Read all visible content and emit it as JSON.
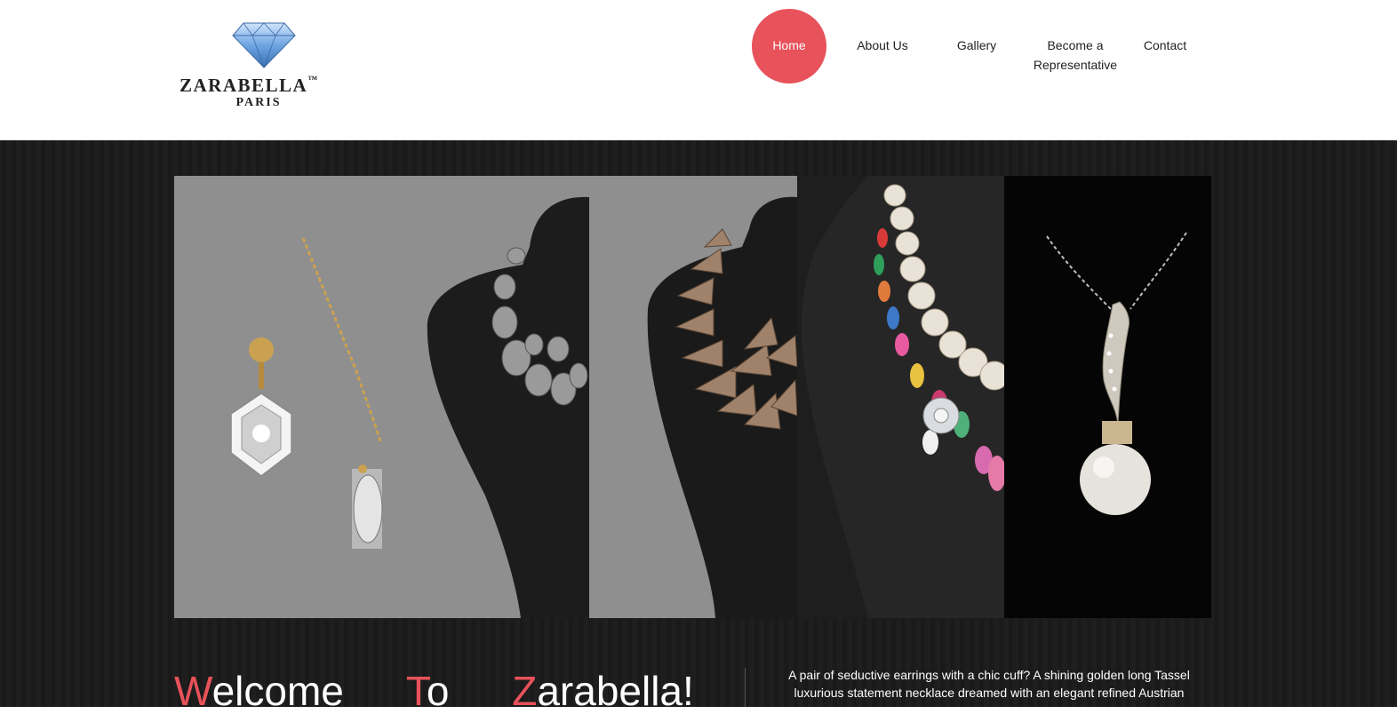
{
  "brand": {
    "name": "ZARABELLA",
    "trademark": "™",
    "subtitle": "PARIS"
  },
  "nav": {
    "items": [
      {
        "label": "Home",
        "active": true
      },
      {
        "label": "About Us"
      },
      {
        "label": "Gallery"
      },
      {
        "label": "Become a Representative"
      },
      {
        "label": "Contact"
      }
    ]
  },
  "gallery": {
    "panels": [
      {
        "icon": "earrings-and-necklace-image"
      },
      {
        "icon": "statement-necklace-image"
      },
      {
        "icon": "pearl-flower-necklace-image"
      },
      {
        "icon": "pearl-pendant-image"
      }
    ]
  },
  "welcome": {
    "word1_first": "W",
    "word1_rest": "elcome",
    "word2_first": "T",
    "word2_rest": "o",
    "word3_first": "Z",
    "word3_rest": "arabella!"
  },
  "description": "A pair of seductive earrings with a chic cuff? A shining golden long Tassel luxurious statement necklace dreamed with an elegant refined Austrian",
  "colors": {
    "accent": "#e8525a",
    "hero_bg": "#1b1b1b",
    "header_bg": "#ffffff"
  }
}
